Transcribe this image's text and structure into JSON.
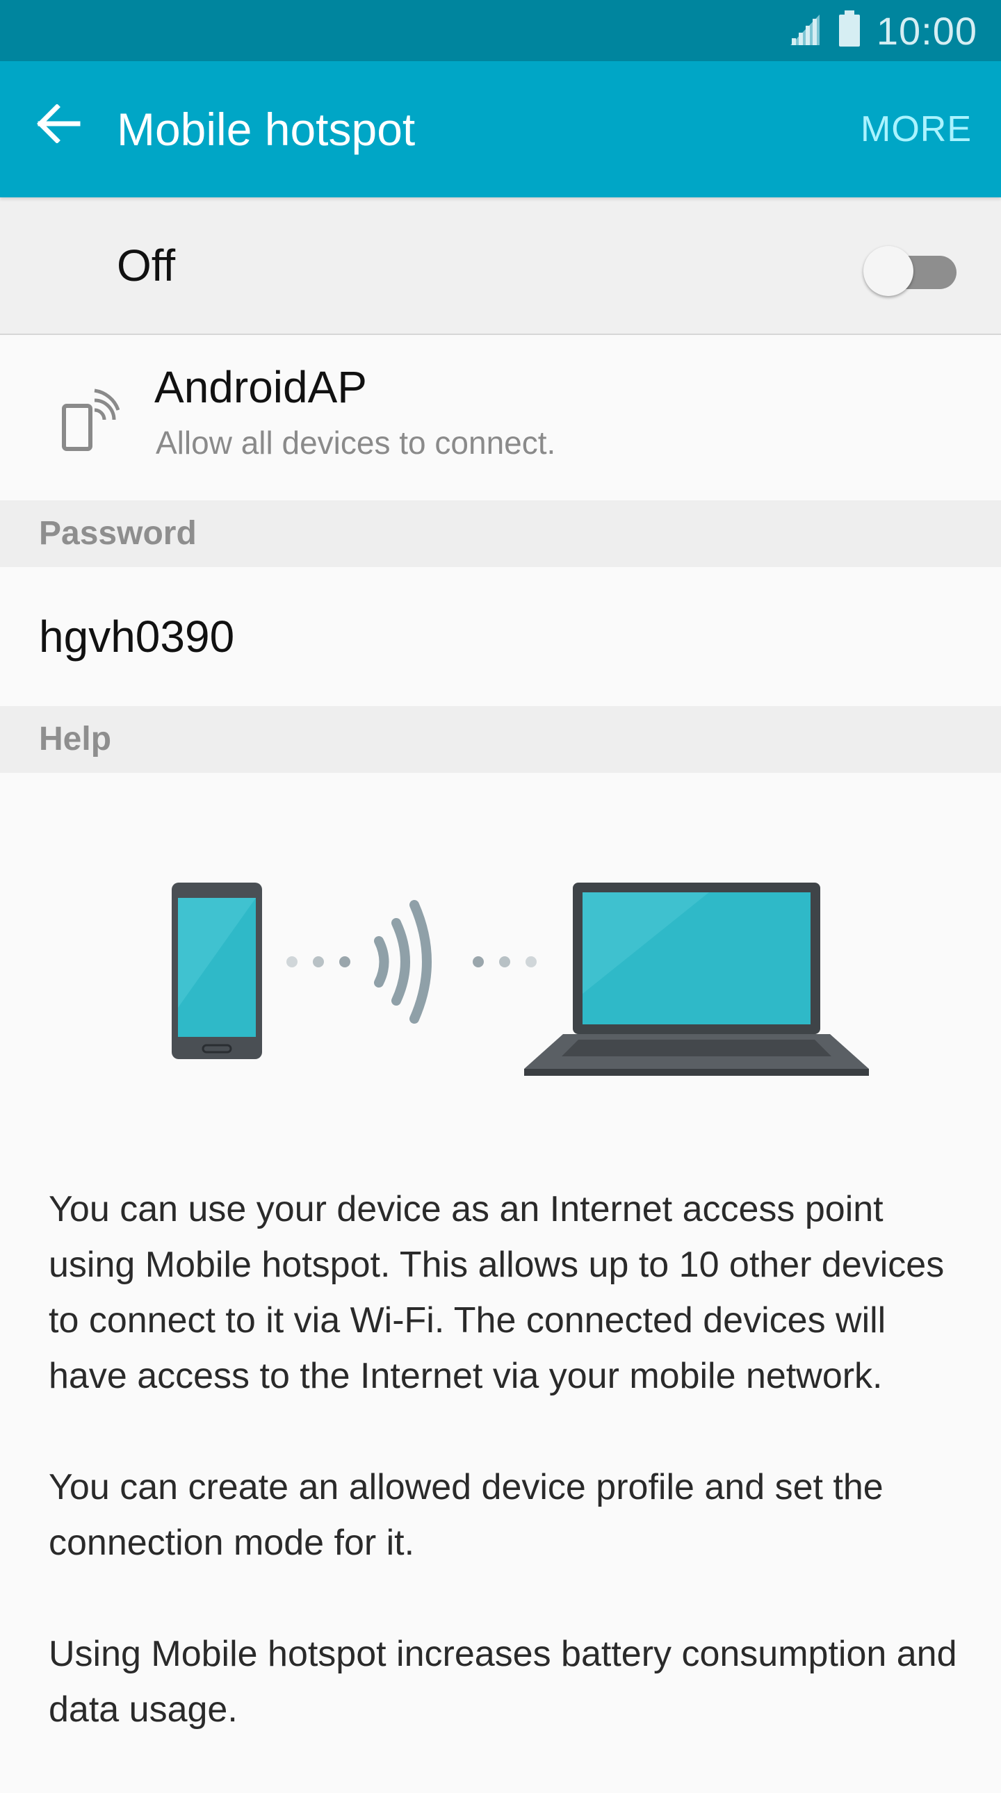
{
  "status_bar": {
    "time": "10:00",
    "icons": [
      "signal-icon",
      "battery-icon"
    ]
  },
  "app_bar": {
    "title": "Mobile hotspot",
    "back_icon": "arrow-back-icon",
    "more_label": "MORE"
  },
  "toggle": {
    "label": "Off",
    "checked": false
  },
  "network": {
    "icon": "hotspot-phone-icon",
    "name": "AndroidAP",
    "subtitle": "Allow all devices to connect."
  },
  "password_section": {
    "header": "Password",
    "value": "hgvh0390"
  },
  "help_section": {
    "header": "Help",
    "paragraphs": [
      "You can use your device as an Internet access point using Mobile hotspot. This allows up to 10 other devices to connect to it via Wi-Fi. The connected devices will have access to the Internet via your mobile network.",
      "You can create an allowed device profile and set the connection mode for it.",
      "Using Mobile hotspot increases battery consumption and data usage."
    ]
  },
  "colors": {
    "status_bar": "#00859e",
    "app_bar": "#00a6c6",
    "more_text": "#aaf3ff",
    "screen_teal": "#2fb9c8",
    "device_body": "#4a4f54",
    "wave": "#8fa0a8"
  }
}
